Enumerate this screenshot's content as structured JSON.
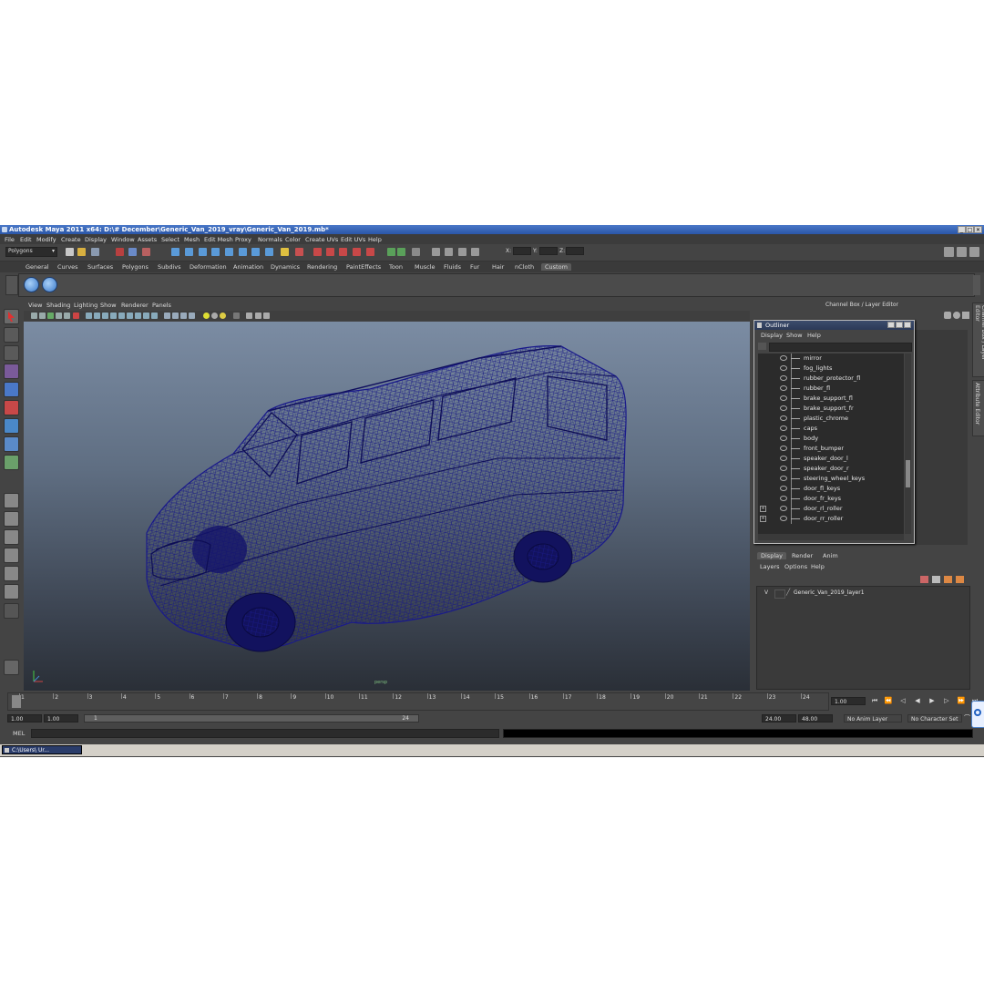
{
  "window": {
    "title": "Autodesk Maya 2011 x64: D:\\# December\\Generic_Van_2019_vray\\Generic_Van_2019.mb*",
    "controls": [
      "_",
      "□",
      "✕"
    ]
  },
  "menubar": [
    "File",
    "Edit",
    "Modify",
    "Create",
    "Display",
    "Window",
    "Assets",
    "Select",
    "Mesh",
    "Edit Mesh",
    "Proxy",
    "Normals",
    "Color",
    "Create UVs",
    "Edit UVs",
    "Help"
  ],
  "statusline": {
    "menu_set": "Polygons",
    "x_label": "X:",
    "y_label": "Y:",
    "z_label": "Z:"
  },
  "shelf_tabs": [
    "General",
    "Curves",
    "Surfaces",
    "Polygons",
    "Subdivs",
    "Deformation",
    "Animation",
    "Dynamics",
    "Rendering",
    "PaintEffects",
    "Toon",
    "Muscle",
    "Fluids",
    "Fur",
    "Hair",
    "nCloth",
    "Custom"
  ],
  "shelf_active": "Custom",
  "viewport": {
    "menu": [
      "View",
      "Shading",
      "Lighting",
      "Show",
      "Renderer",
      "Panels"
    ],
    "camera_label": "persp",
    "wire_color": "#1a1a8c"
  },
  "channel_box_header": "Channel Box / Layer Editor",
  "side_tabs": [
    "Channel Box / Layer Editor",
    "Attribute Editor"
  ],
  "outliner": {
    "title": "Outliner",
    "menu": [
      "Display",
      "Show",
      "Help"
    ],
    "items": [
      {
        "name": "mirror",
        "expandable": false
      },
      {
        "name": "fog_lights",
        "expandable": false
      },
      {
        "name": "rubber_protector_fl",
        "expandable": false
      },
      {
        "name": "rubber_fl",
        "expandable": false
      },
      {
        "name": "brake_support_fl",
        "expandable": false
      },
      {
        "name": "brake_support_fr",
        "expandable": false
      },
      {
        "name": "plastic_chrome",
        "expandable": false
      },
      {
        "name": "caps",
        "expandable": false
      },
      {
        "name": "body",
        "expandable": false
      },
      {
        "name": "front_bumper",
        "expandable": false
      },
      {
        "name": "speaker_door_l",
        "expandable": false
      },
      {
        "name": "speaker_door_r",
        "expandable": false
      },
      {
        "name": "steering_wheel_keys",
        "expandable": false
      },
      {
        "name": "door_fl_keys",
        "expandable": false
      },
      {
        "name": "door_fr_keys",
        "expandable": false
      },
      {
        "name": "door_rl_roller",
        "expandable": true
      },
      {
        "name": "door_rr_roller",
        "expandable": true
      }
    ]
  },
  "layer_editor": {
    "tabs": [
      "Display",
      "Render",
      "Anim"
    ],
    "active_tab": "Display",
    "menu": [
      "Layers",
      "Options",
      "Help"
    ],
    "layers": [
      {
        "visible": "V",
        "name": "Generic_Van_2019_layer1"
      }
    ]
  },
  "time_slider": {
    "ticks": [
      "1",
      "2",
      "3",
      "4",
      "5",
      "6",
      "7",
      "8",
      "9",
      "10",
      "11",
      "12",
      "13",
      "14",
      "15",
      "16",
      "17",
      "18",
      "19",
      "20",
      "21",
      "22",
      "23",
      "24"
    ],
    "current_frame": "1.00"
  },
  "range": {
    "start": "1.00",
    "playback_start": "1.00",
    "slider_start": "1",
    "slider_end": "24",
    "playback_end": "24.00",
    "end": "48.00",
    "anim_layer": "No Anim Layer",
    "character_set": "No Character Set"
  },
  "command_line": {
    "label": "MEL"
  },
  "taskbar": {
    "item": "C:\\Users\\ Ur..."
  }
}
